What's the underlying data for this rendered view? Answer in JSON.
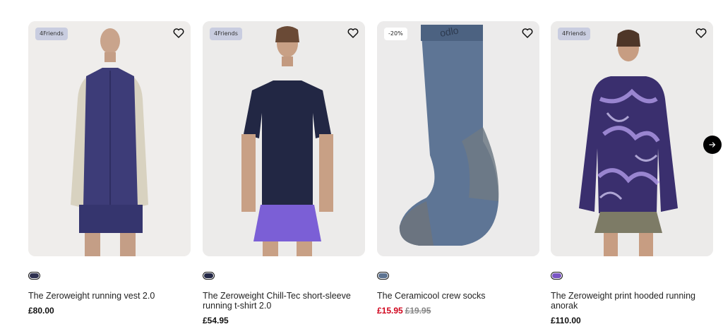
{
  "products": [
    {
      "badge": "4Friends",
      "title": "The Zeroweight running vest 2.0",
      "price": "£80.00",
      "old_price": "",
      "swatch_color": "#2f3150",
      "icon": "heart-icon"
    },
    {
      "badge": "4Friends",
      "title": "The Zeroweight Chill-Tec short-sleeve running t-shirt 2.0",
      "price": "£54.95",
      "old_price": "",
      "swatch_color": "#232846",
      "icon": "heart-icon"
    },
    {
      "badge": "-20%",
      "title": "The Ceramicool crew socks",
      "price": "£15.95",
      "old_price": "£19.95",
      "swatch_color": "#5d7391",
      "icon": "heart-icon"
    },
    {
      "badge": "4Friends",
      "title": "The Zeroweight print hooded running anorak",
      "price": "£110.00",
      "old_price": "",
      "swatch_color": "#7a55c4",
      "icon": "heart-icon"
    }
  ],
  "carousel": {
    "next_icon": "arrow-right-icon"
  },
  "colors": {
    "sale_price": "#d0021b",
    "badge_bg": "#c9cde0"
  }
}
